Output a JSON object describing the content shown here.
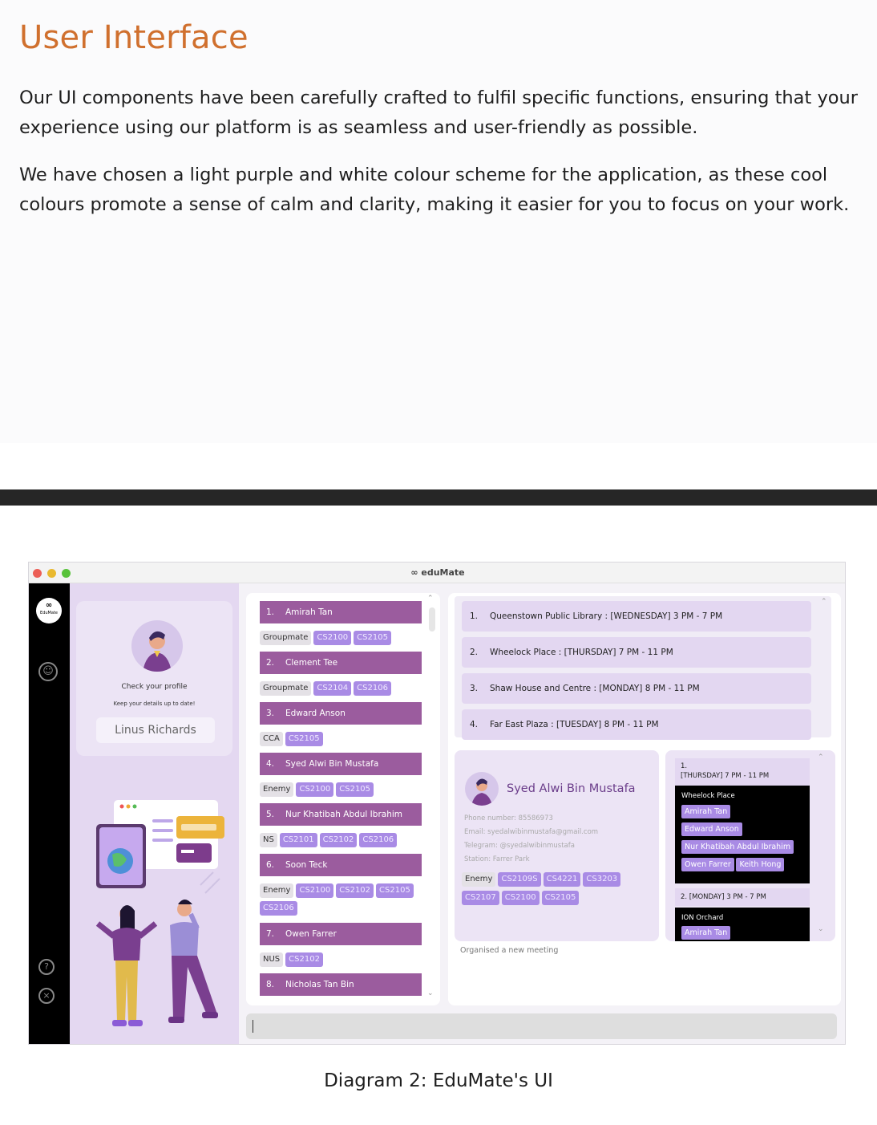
{
  "heading": "User Interface",
  "paragraphs": [
    "Our UI components have been carefully crafted to fulfil specific functions, ensuring that your experience using our platform is as seamless and user-friendly as possible.",
    "We have chosen a light purple and white colour scheme for the application, as these cool colours promote a sense of calm and clarity, making it easier for you to focus on your work."
  ],
  "caption": "Diagram 2: EduMate's UI",
  "colors": {
    "heading": "#d0702e",
    "accent_purple": "#9b5c9e",
    "tag_purple": "#a98be5",
    "pane_lavender": "#e4d8f1"
  },
  "app": {
    "window_title": "eduMate",
    "logo_text": "EduMate",
    "profile": {
      "prompt": "Check your profile",
      "subprompt": "Keep your details up to date!",
      "name": "Linus Richards"
    },
    "contacts": [
      {
        "num": "1.",
        "name": "Amirah Tan",
        "tags": [
          "Groupmate",
          "CS2100",
          "CS2105"
        ]
      },
      {
        "num": "2.",
        "name": "Clement Tee",
        "tags": [
          "Groupmate",
          "CS2104",
          "CS2106"
        ]
      },
      {
        "num": "3.",
        "name": "Edward Anson",
        "tags": [
          "CCA",
          "CS2105"
        ]
      },
      {
        "num": "4.",
        "name": "Syed Alwi Bin Mustafa",
        "tags": [
          "Enemy",
          "CS2100",
          "CS2105"
        ]
      },
      {
        "num": "5.",
        "name": "Nur Khatibah Abdul Ibrahim",
        "tags": [
          "NS",
          "CS2101",
          "CS2102",
          "CS2106"
        ]
      },
      {
        "num": "6.",
        "name": "Soon Teck",
        "tags": [
          "Enemy",
          "CS2100",
          "CS2102",
          "CS2105"
        ],
        "tags2": [
          "CS2106"
        ]
      },
      {
        "num": "7.",
        "name": "Owen Farrer",
        "tags": [
          "NUS",
          "CS2102"
        ]
      },
      {
        "num": "8.",
        "name": "Nicholas Tan Bin",
        "tags": []
      }
    ],
    "meetings": [
      {
        "num": "1.",
        "text": "Queenstown Public Library : [WEDNESDAY] 3 PM - 7 PM"
      },
      {
        "num": "2.",
        "text": "Wheelock Place : [THURSDAY] 7 PM - 11 PM"
      },
      {
        "num": "3.",
        "text": "Shaw House and Centre : [MONDAY] 8 PM - 11 PM"
      },
      {
        "num": "4.",
        "text": "Far East Plaza : [TUESDAY] 8 PM - 11 PM"
      }
    ],
    "detail": {
      "name": "Syed Alwi Bin Mustafa",
      "phone": "Phone number: 85586973",
      "email": "Email: syedalwibinmustafa@gmail.com",
      "telegram": "Telegram: @syedalwibinmustafa",
      "station": "Station: Farrer Park",
      "tags_row1": [
        "Enemy",
        "CS2109S",
        "CS4221",
        "CS3203"
      ],
      "tags_row2": [
        "CS2107",
        "CS2100",
        "CS2105"
      ]
    },
    "group_meetings": {
      "slot1_num": "1.",
      "slot1_time": "[THURSDAY] 7 PM - 11 PM",
      "slot1_place": "Wheelock Place",
      "slot1_people": [
        "Amirah Tan",
        "Edward Anson",
        "Nur Khatibah Abdul Ibrahim",
        "Owen Farrer",
        "Keith Hong"
      ],
      "slot2_time": "2. [MONDAY] 3 PM - 7 PM",
      "slot2_place": "ION Orchard",
      "slot2_people": [
        "Amirah Tan"
      ]
    },
    "status_message": "Organised a new meeting",
    "command_value": ""
  }
}
